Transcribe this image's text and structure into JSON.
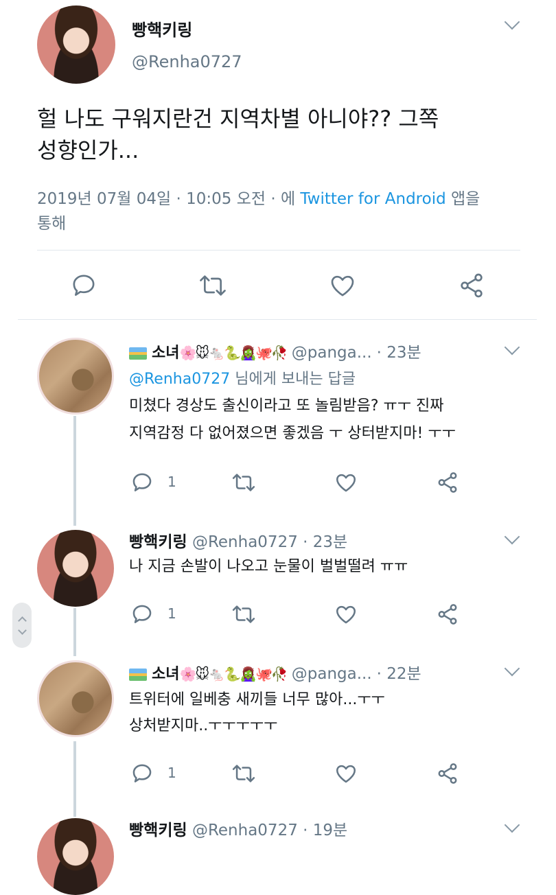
{
  "main_tweet": {
    "display_name": "빵핵키링",
    "handle": "@Renha0727",
    "text_line1": "헐 나도 구워지란건 지역차별 아니야?? 그쪽",
    "text_line2": "성향인가...",
    "meta_prefix": "2019년 07월 04일 · 10:05 오전 · 에",
    "meta_source": "Twitter for Android",
    "meta_suffix": "앱을",
    "meta_line2": "통해"
  },
  "replies": [
    {
      "display_name": "소녀",
      "emoji": "🌸🐭🐁🐍🧟‍♀️🐙🥀",
      "handle": "@panga...",
      "time": "· 23분",
      "reply_to": "@Renha0727",
      "reply_to_suffix": "님에게 보내는 답글",
      "text_line1": "미쳤다 경상도 출신이라고 또 놀림받음? ㅠㅜ 진짜",
      "text_line2": "지역감정 다 없어졌으면 좋겠음 ㅜ 상터받지마! ㅜㅜ",
      "reply_count": "1"
    },
    {
      "display_name": "빵핵키링",
      "handle": "@Renha0727",
      "time": "· 23분",
      "text_line1": "나 지금 손발이 나오고 눈물이 벌벌떨려 ㅠㅠ",
      "reply_count": "1"
    },
    {
      "display_name": "소녀",
      "emoji": "🌸🐭🐁🐍🧟‍♀️🐙🥀",
      "handle": "@panga...",
      "time": "· 22분",
      "text_line1": "트위터에 일베충 새끼들 너무 많아...ㅜㅜ",
      "text_line2": "상처받지마..ㅜㅜㅜㅜㅜ",
      "reply_count": "1"
    },
    {
      "display_name": "빵핵키링",
      "handle": "@Renha0727",
      "time": "· 19분"
    }
  ],
  "icons": [
    "reply-icon",
    "retweet-icon",
    "like-icon",
    "share-icon",
    "chevron-down-icon",
    "rainbow-icon"
  ],
  "colors": {
    "link": "#1b95e0",
    "muted": "#657786",
    "divider": "#e1e8ed"
  }
}
